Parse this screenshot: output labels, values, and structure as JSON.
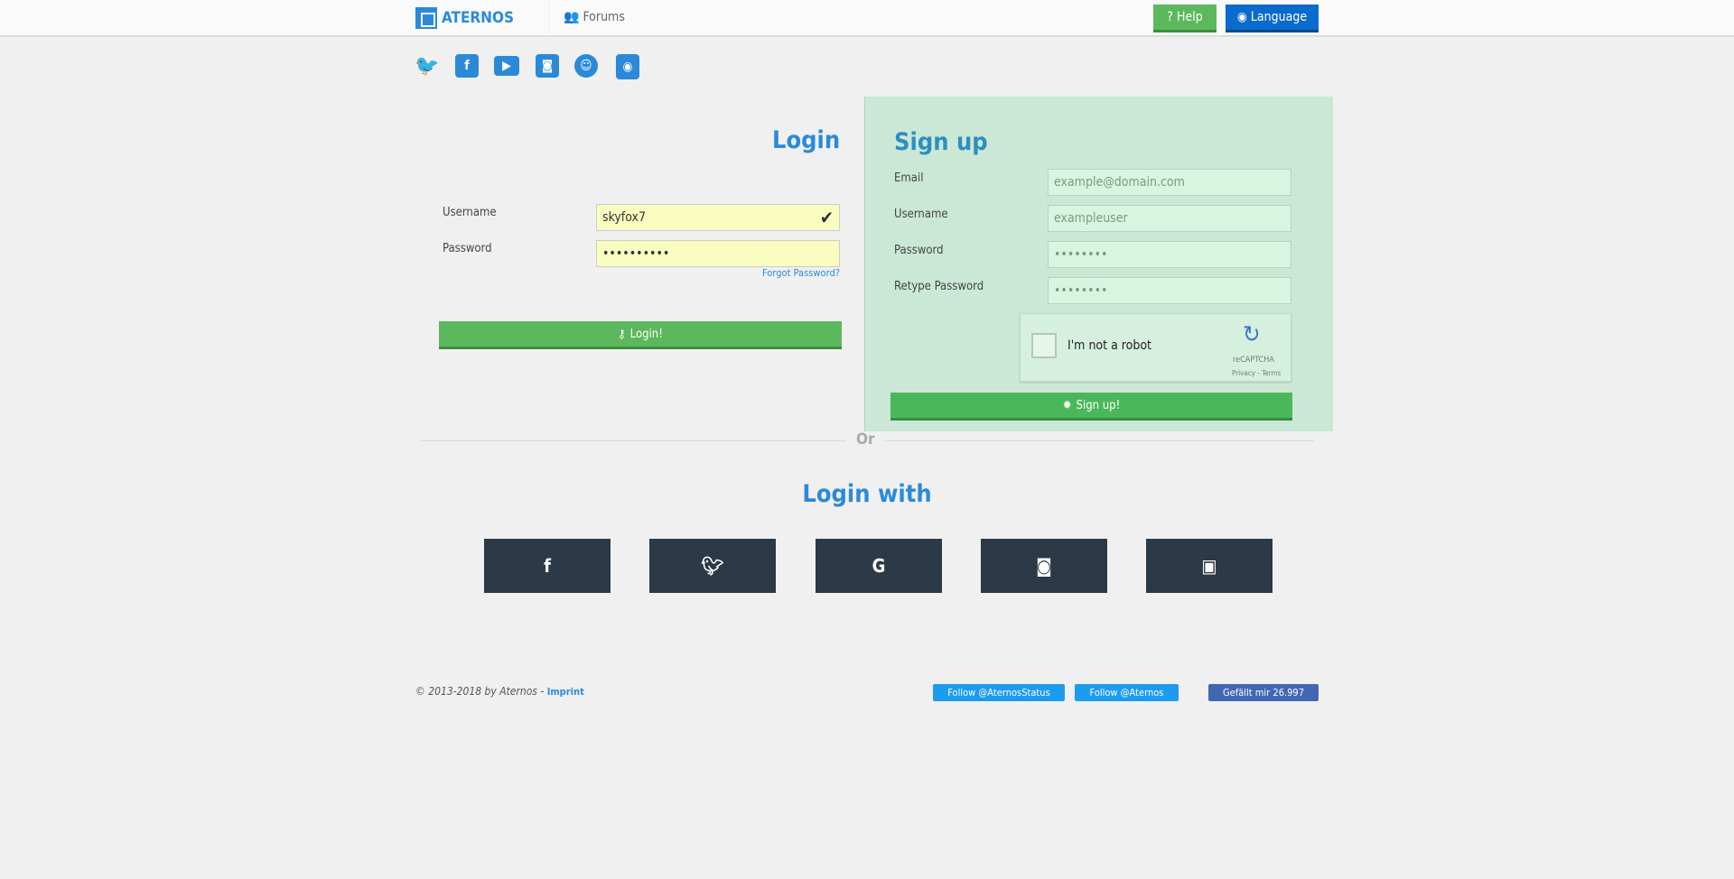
{
  "header": {
    "brand": "ATERNOS",
    "forums": "Forums",
    "help": "Help",
    "language": "Language"
  },
  "social_icons": [
    "twitter-icon",
    "facebook-icon",
    "youtube-icon",
    "instagram-icon",
    "reddit-icon",
    "discord-icon"
  ],
  "login": {
    "title": "Login",
    "username_label": "Username",
    "username_value": "skyfox7",
    "password_label": "Password",
    "password_value": "••••••••••",
    "forgot": "Forgot Password?",
    "button": "Login!"
  },
  "signup": {
    "title": "Sign up",
    "email_label": "Email",
    "email_placeholder": "example@domain.com",
    "username_label": "Username",
    "username_placeholder": "exampleuser",
    "password_label": "Password",
    "password_placeholder": "••••••••",
    "retype_label": "Retype Password",
    "retype_placeholder": "••••••••",
    "captcha_text": "I'm not a robot",
    "captcha_brand": "reCAPTCHA",
    "captcha_links": "Privacy - Terms",
    "button": "Sign up!"
  },
  "divider": "Or",
  "login_with": {
    "title": "Login with",
    "providers": [
      "f",
      "t",
      "G",
      "ig",
      "tw"
    ]
  },
  "footer": {
    "copyright": "© 2013-2018 by Aternos - ",
    "imprint": "Imprint",
    "follow_status": "Follow @AternosStatus",
    "follow_aternos": "Follow @Aternos",
    "like": "Gefällt mir 26.997"
  },
  "colors": {
    "accent": "#2b8ad8",
    "green": "#5cb85c",
    "signup_bg": "#cbe8d7",
    "dark": "#2c3a47"
  }
}
